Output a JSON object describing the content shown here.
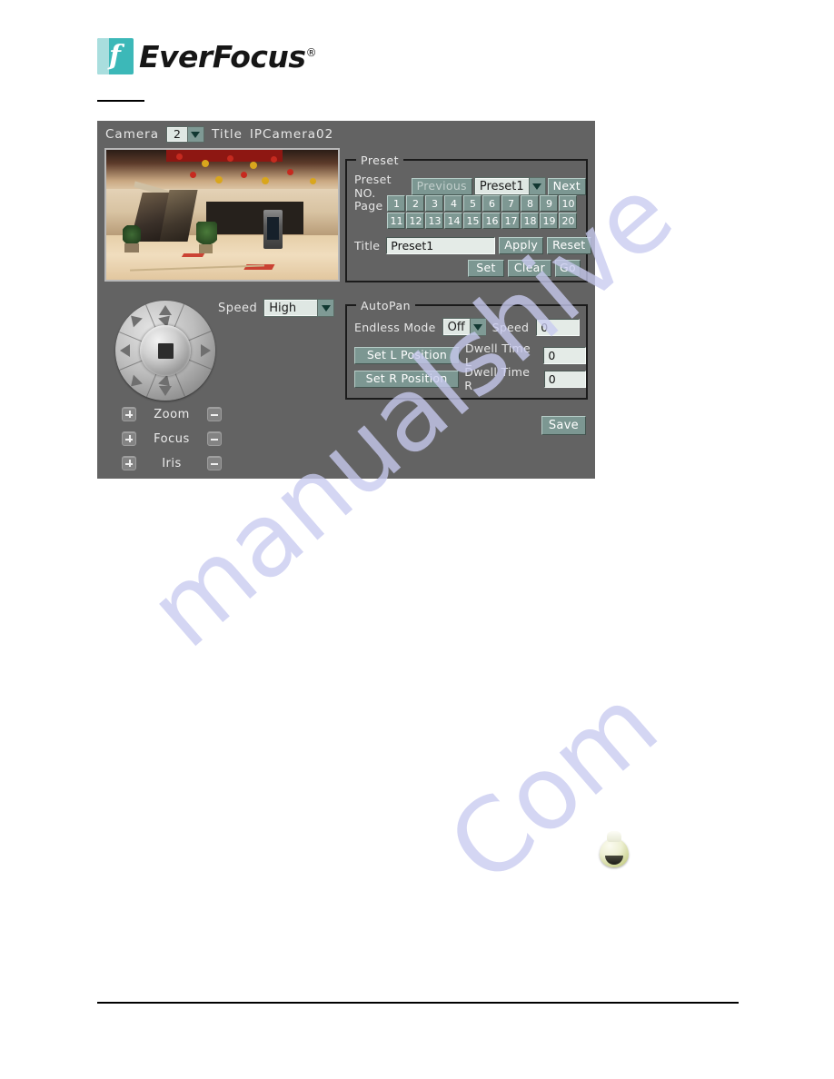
{
  "brand": {
    "name": "EverFocus",
    "registered_mark": "®",
    "logo_letter": "f"
  },
  "panel": {
    "camera_label": "Camera",
    "camera_value": "2",
    "title_label": "Title",
    "camera_title": "IPCamera02",
    "speed_label": "Speed",
    "speed_value": "High",
    "save_label": "Save"
  },
  "lens": {
    "rows": [
      {
        "label": "Zoom",
        "plus": "+",
        "minus": "-"
      },
      {
        "label": "Focus",
        "plus": "+",
        "minus": "-"
      },
      {
        "label": "Iris",
        "plus": "+",
        "minus": "-"
      }
    ]
  },
  "preset": {
    "group_title": "Preset",
    "no_label": "Preset  NO.",
    "previous_label": "Previous",
    "selected": "Preset1",
    "next_label": "Next",
    "page_label": "Page",
    "pages": [
      "1",
      "2",
      "3",
      "4",
      "5",
      "6",
      "7",
      "8",
      "9",
      "10",
      "11",
      "12",
      "13",
      "14",
      "15",
      "16",
      "17",
      "18",
      "19",
      "20"
    ],
    "title_label": "Title",
    "title_value": "Preset1",
    "apply_label": "Apply",
    "reset_label": "Reset",
    "set_label": "Set",
    "clear_label": "Clear",
    "go_label": "Go"
  },
  "autopan": {
    "group_title": "AutoPan",
    "endless_mode_label": "Endless  Mode",
    "endless_mode_value": "Off",
    "speed_label": "Speed",
    "speed_value": "0",
    "set_l_label": "Set  L  Position",
    "dwell_l_label": "Dwell  Time  L",
    "dwell_l_value": "0",
    "set_r_label": "Set  R  Position",
    "dwell_r_label": "Dwell  Time  R",
    "dwell_r_value": "0"
  },
  "watermark": {
    "text_a": "manualshive",
    "text_b": "Com"
  },
  "colors": {
    "brand_teal": "#3cb8b8",
    "panel_bg": "#636363",
    "button_teal": "#7c9792",
    "input_bg": "#e4ebe7",
    "text_light": "#e6e6e6"
  }
}
